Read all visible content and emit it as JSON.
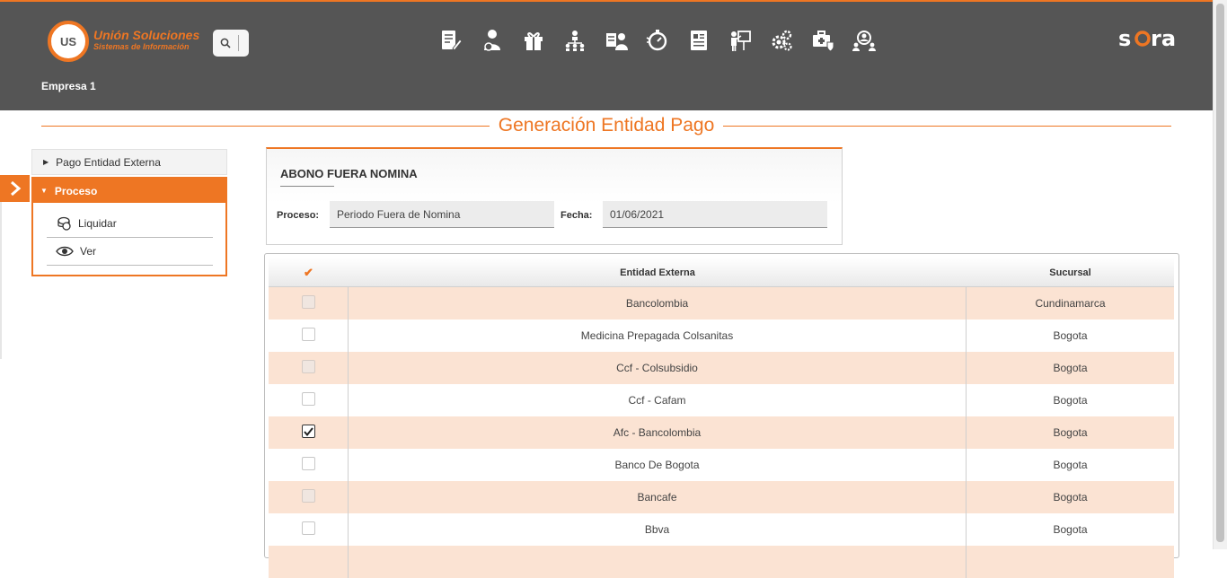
{
  "header": {
    "logo": {
      "badge": "US",
      "name": "Unión Soluciones",
      "tagline": "Sistemas de Información"
    },
    "brand": "sara",
    "company": "Empresa 1",
    "nav_icons": [
      "document-edit-icon",
      "person-money-icon",
      "gift-icon",
      "org-chart-icon",
      "person-id-icon",
      "stopwatch-icon",
      "report-icon",
      "presentation-icon",
      "gears-icon",
      "medical-briefcase-icon",
      "group-search-icon"
    ],
    "accent": "#ee7623",
    "bg": "#555555"
  },
  "page_title": "Generación Entidad Pago",
  "sidebar": {
    "items": [
      {
        "label": "Pago Entidad Externa",
        "expanded": false
      }
    ],
    "group": {
      "label": "Proceso",
      "expanded": true,
      "items": [
        {
          "label": "Liquidar",
          "icon": "coins-icon"
        },
        {
          "label": "Ver",
          "icon": "eye-icon"
        }
      ]
    }
  },
  "form": {
    "title": "ABONO FUERA NOMINA",
    "proceso_label": "Proceso:",
    "proceso_value": "Periodo Fuera de Nomina",
    "fecha_label": "Fecha:",
    "fecha_value": "01/06/2021"
  },
  "table": {
    "columns": [
      "✔",
      "Entidad Externa",
      "Sucursal"
    ],
    "rows": [
      {
        "checked": false,
        "entidad": "Bancolombia",
        "sucursal": "Cundinamarca"
      },
      {
        "checked": false,
        "entidad": "Medicina Prepagada Colsanitas",
        "sucursal": "Bogota"
      },
      {
        "checked": false,
        "entidad": "Ccf - Colsubsidio",
        "sucursal": "Bogota"
      },
      {
        "checked": false,
        "entidad": "Ccf - Cafam",
        "sucursal": "Bogota"
      },
      {
        "checked": true,
        "entidad": "Afc - Bancolombia",
        "sucursal": "Bogota"
      },
      {
        "checked": false,
        "entidad": "Banco De Bogota",
        "sucursal": "Bogota"
      },
      {
        "checked": false,
        "entidad": "Bancafe",
        "sucursal": "Bogota"
      },
      {
        "checked": false,
        "entidad": "Bbva",
        "sucursal": "Bogota"
      }
    ]
  }
}
